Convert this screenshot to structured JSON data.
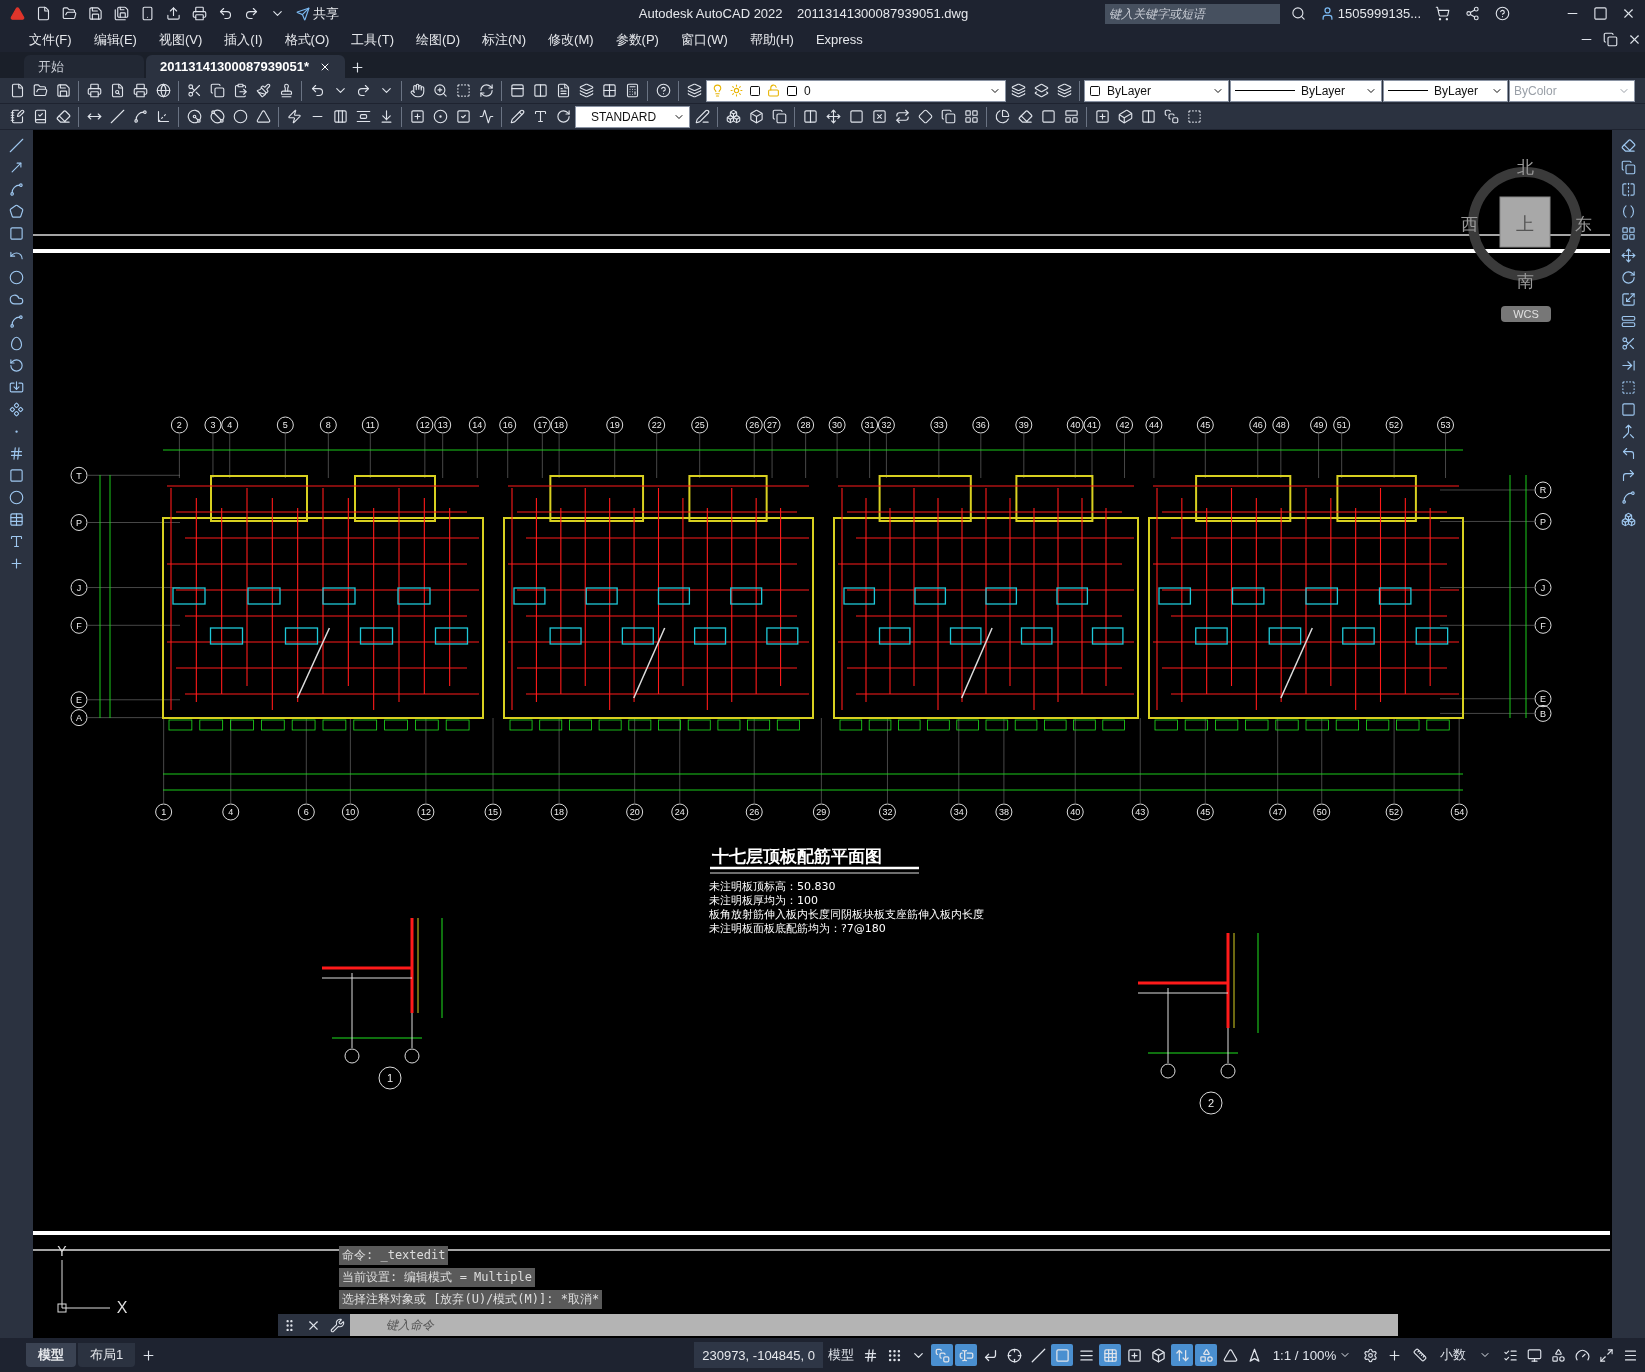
{
  "title_bar": {
    "share_label": "共享",
    "app_title": "Autodesk AutoCAD 2022",
    "file_name": "20113141300087939051.dwg",
    "search": {
      "placeholder": "键入关键字或短语"
    },
    "user": "1505999135..."
  },
  "menu_bar": [
    "文件(F)",
    "编辑(E)",
    "视图(V)",
    "插入(I)",
    "格式(O)",
    "工具(T)",
    "绘图(D)",
    "标注(N)",
    "修改(M)",
    "参数(P)",
    "窗口(W)",
    "帮助(H)",
    "Express"
  ],
  "file_tabs": [
    {
      "label": "开始",
      "selected": false
    },
    {
      "label": "20113141300087939051*",
      "selected": true
    }
  ],
  "toolbars": {
    "layer": "0",
    "text_style": "STANDARD",
    "color_control": "ByLayer",
    "linetype": "ByLayer",
    "lineweight": "ByLayer",
    "plot_style": {
      "value": "ByColor",
      "disabled": true
    }
  },
  "drawing": {
    "top_axes": [
      "2",
      "3",
      "4",
      "5",
      "8",
      "11",
      "12",
      "13",
      "14",
      "16",
      "17",
      "18",
      "19",
      "22",
      "25",
      "26",
      "27",
      "28",
      "30",
      "31",
      "32",
      "33",
      "36",
      "39",
      "40",
      "41",
      "42",
      "44",
      "45",
      "46",
      "48",
      "49",
      "51",
      "52",
      "53"
    ],
    "bottom_axes": [
      "1",
      "4",
      "6",
      "10",
      "12",
      "15",
      "18",
      "20",
      "24",
      "26",
      "29",
      "32",
      "34",
      "38",
      "40",
      "43",
      "45",
      "47",
      "50",
      "52",
      "54"
    ],
    "left_axes": [
      "T",
      "P",
      "J",
      "F",
      "E",
      "A"
    ],
    "right_axes": [
      "R",
      "P",
      "J",
      "F",
      "E",
      "B"
    ],
    "title": "十七层顶板配筋平面图",
    "notes": [
      "未注明板顶标高：50.830",
      "未注明板厚均为：100",
      "板角放射筋伸入板内长度同阴板块板支座筋伸入板内长度",
      "未注明板面板底配筋均为：?7@180"
    ],
    "detail_markers": [
      "1",
      "2"
    ]
  },
  "view_cube": {
    "north": "北",
    "south": "南",
    "west": "西",
    "east": "东",
    "face": "上",
    "ucs": "WCS"
  },
  "ucs_icon": {
    "x": "X",
    "y": "Y"
  },
  "command_history": [
    "命令: _textedit",
    "当前设置: 编辑模式 = Multiple",
    "选择注释对象或 [放弃(U)/模式(M)]: *取消*"
  ],
  "command_line": {
    "placeholder": "键入命令"
  },
  "layout_tabs": [
    {
      "label": "模型",
      "selected": true
    },
    {
      "label": "布局1",
      "selected": false
    }
  ],
  "status_bar": {
    "coordinates": "230973, -104845, 0",
    "space": "模型",
    "annotation_scale": "1:1 / 100%",
    "units": "小数",
    "toggles": [
      {
        "on": false
      },
      {
        "on": false
      },
      {
        "on": false
      },
      {
        "on": true
      },
      {
        "on": true
      },
      {
        "on": false
      },
      {
        "on": false
      },
      {
        "on": false
      },
      {
        "on": true
      },
      {
        "on": false
      },
      {
        "on": true
      },
      {
        "on": false
      },
      {
        "on": false
      },
      {
        "on": true
      },
      {
        "on": true
      },
      {
        "on": false
      },
      {
        "on": false
      }
    ]
  }
}
